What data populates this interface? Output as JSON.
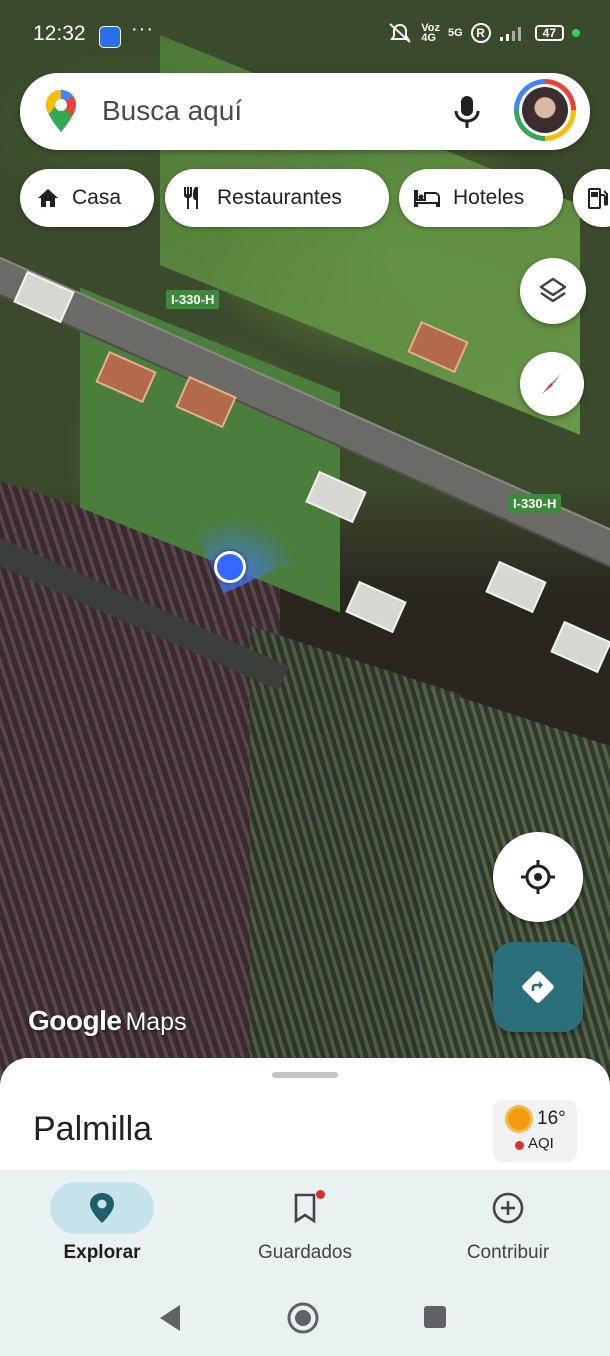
{
  "status_bar": {
    "time": "12:32",
    "overflow": "···",
    "network_label": "Voz\n4G",
    "network_5g": "5G",
    "roaming": "R",
    "battery": "47",
    "icons": [
      "messages-app-icon",
      "mute-icon",
      "signal-icon",
      "roaming-icon",
      "battery-icon"
    ]
  },
  "search": {
    "placeholder": "Busca aquí",
    "icons": [
      "google-maps-pin-icon",
      "microphone-icon",
      "account-avatar"
    ]
  },
  "chips": [
    {
      "label": "Casa",
      "icon": "home-icon"
    },
    {
      "label": "Restaurantes",
      "icon": "restaurant-icon"
    },
    {
      "label": "Hoteles",
      "icon": "hotel-icon"
    },
    {
      "label": "",
      "icon": "gas-station-icon"
    }
  ],
  "map": {
    "road_labels": [
      "I-330-H",
      "I-330-H"
    ],
    "watermark_google": "Google",
    "watermark_maps": "Maps",
    "buttons": [
      "layers-icon",
      "compass-icon",
      "my-location-icon",
      "directions-icon"
    ]
  },
  "sheet": {
    "place_name": "Palmilla",
    "temperature": "16°",
    "aqi_label": "AQI"
  },
  "nav": [
    {
      "label": "Explorar",
      "icon": "explore-pin-icon",
      "active": true
    },
    {
      "label": "Guardados",
      "icon": "bookmark-icon",
      "active": false
    },
    {
      "label": "Contribuir",
      "icon": "add-circle-icon",
      "active": false
    }
  ],
  "colors": {
    "accent_teal": "#2b6f7a",
    "location_blue": "#3367ff",
    "nav_active_bg": "#c6e3ec"
  }
}
